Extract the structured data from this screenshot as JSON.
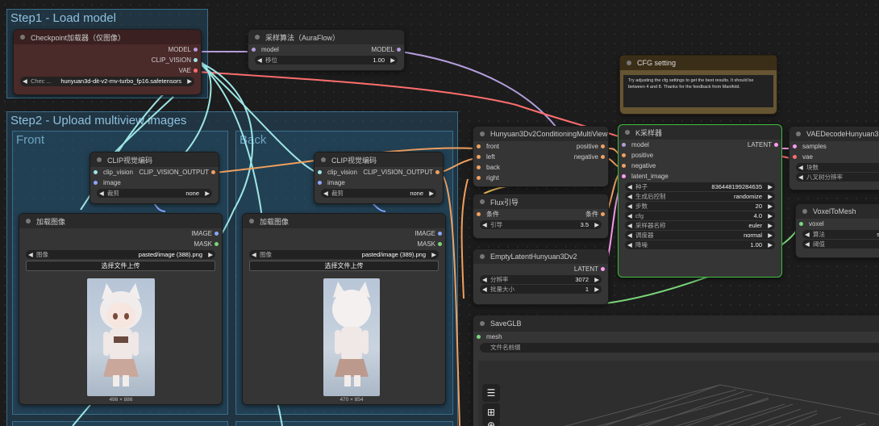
{
  "groups": {
    "step1": "Step1 - Load model",
    "step2": "Step2 - Upload multiview images",
    "front": "Front",
    "back": "Back"
  },
  "checkpoint": {
    "title": "Checkpoint加载器（仅图像）",
    "out_model": "MODEL",
    "out_clip_vision": "CLIP_VISION",
    "out_vae": "VAE",
    "ckpt_label": "Chec ...",
    "ckpt_value": "hunyuan3d-dit-v2-mv-turbo_fp16.safetensors"
  },
  "sampling": {
    "title": "采样算法（AuraFlow）",
    "in_model": "model",
    "out_model": "MODEL",
    "shift_label": "移位",
    "shift_value": "1.00"
  },
  "cfg_note": {
    "title": "CFG setting",
    "text": "Try adjusting the cfg settings to get the best results. It should be between 4 and 8. Thanks for the feedback from Manifold."
  },
  "clip_front": {
    "title": "CLIP视觉编码",
    "in_clip_vision": "clip_vision",
    "in_image": "image",
    "out": "CLIP_VISION_OUTPUT",
    "crop_label": "裁剪",
    "crop_value": "none"
  },
  "clip_back": {
    "title": "CLIP视觉编码",
    "in_clip_vision": "clip_vision",
    "in_image": "image",
    "out": "CLIP_VISION_OUTPUT",
    "crop_label": "裁剪",
    "crop_value": "none"
  },
  "load_front": {
    "title": "加载图像",
    "out_image": "IMAGE",
    "out_mask": "MASK",
    "image_label": "图像",
    "image_value": "pasted/image (388).png",
    "upload": "选择文件上传",
    "size": "498 × 886"
  },
  "load_back": {
    "title": "加载图像",
    "out_image": "IMAGE",
    "out_mask": "MASK",
    "image_label": "图像",
    "image_value": "pasted/image (389).png",
    "upload": "选择文件上传",
    "size": "470 × 854"
  },
  "multiview": {
    "title": "Hunyuan3Dv2ConditioningMultiView",
    "in_front": "front",
    "in_left": "left",
    "in_back": "back",
    "in_right": "right",
    "out_positive": "positive",
    "out_negative": "negative"
  },
  "flux": {
    "title": "Flux引导",
    "in_cond": "条件",
    "out_cond": "条件",
    "guidance_label": "引导",
    "guidance_value": "3.5"
  },
  "empty_latent": {
    "title": "EmptyLatentHunyuan3Dv2",
    "out": "LATENT",
    "res_label": "分辨率",
    "res_value": "3072",
    "batch_label": "批量大小",
    "batch_value": "1"
  },
  "ksampler": {
    "title": "K采样器",
    "in_model": "model",
    "in_positive": "positive",
    "in_negative": "negative",
    "in_latent": "latent_image",
    "out": "LATENT",
    "seed_label": "种子",
    "seed_value": "836448199284635",
    "control_label": "生成后控制",
    "control_value": "randomize",
    "steps_label": "步数",
    "steps_value": "20",
    "cfg_label": "cfg",
    "cfg_value": "4.0",
    "sampler_label": "采样器名称",
    "sampler_value": "euler",
    "scheduler_label": "调度器",
    "scheduler_value": "normal",
    "denoise_label": "降噪",
    "denoise_value": "1.00"
  },
  "vae_decode": {
    "title": "VAEDecodeHunyuan3D",
    "in_samples": "samples",
    "in_vae": "vae",
    "chunks_label": "块数",
    "octree_label": "八叉树分辨率"
  },
  "voxel": {
    "title": "VoxelToMesh",
    "in_voxel": "voxel",
    "algo_label": "算法",
    "algo_value": "s",
    "threshold_label": "阈值"
  },
  "saveglb": {
    "title": "SaveGLB",
    "in_mesh": "mesh",
    "prefix_label": "文件名前缀"
  },
  "toolbar": {
    "menu_icon": "menu-icon",
    "grid_icon": "grid-icon",
    "globe_icon": "globe-icon"
  }
}
